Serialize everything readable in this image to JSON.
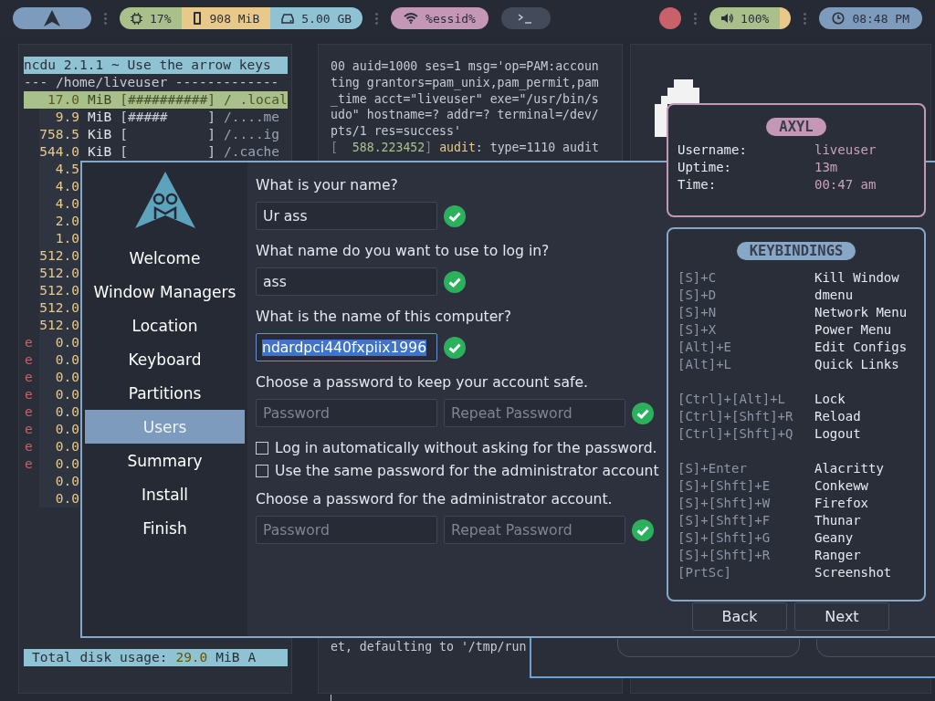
{
  "top_bar": {
    "system": [
      {
        "kind": "cpu",
        "text": "17%",
        "color": "#a9c08a"
      },
      {
        "kind": "memory",
        "text": "908 MiB",
        "color": "#e9c98a"
      },
      {
        "kind": "disk",
        "text": "5.00 GB",
        "color": "#8fc3d3"
      }
    ],
    "network": {
      "text": "%essid%"
    },
    "volume": {
      "text": "100%"
    },
    "clock": {
      "text": "08:48 PM"
    }
  },
  "ncdu": {
    "header": "ncdu 2.1.1 ~ Use the arrow keys",
    "path_line": "--- /home/liveuser -------------",
    "rows": [
      {
        "size": "17.0",
        "unit": "MiB",
        "bar": "[##########]",
        "name": "/ .local",
        "selected": true
      },
      {
        "size": "9.9",
        "unit": "MiB",
        "bar": "[#####     ]",
        "name": "/....me",
        "selected": false
      },
      {
        "size": "758.5",
        "unit": "KiB",
        "bar": "[          ]",
        "name": "/....ig",
        "selected": false
      },
      {
        "size": "544.0",
        "unit": "KiB",
        "bar": "[          ]",
        "name": "/.cache",
        "selected": false
      },
      {
        "size": "4.5",
        "selected": false
      },
      {
        "size": "4.0",
        "selected": false
      },
      {
        "size": "4.0",
        "selected": false
      },
      {
        "size": "2.0",
        "selected": false
      },
      {
        "size": "1.0",
        "selected": false
      },
      {
        "size": "512.0",
        "selected": false
      },
      {
        "size": "512.0",
        "selected": false
      },
      {
        "size": "512.0",
        "selected": false
      },
      {
        "size": "512.0",
        "selected": false
      },
      {
        "size": "512.0",
        "selected": false
      },
      {
        "size": "0.0",
        "flag": "e",
        "selected": false
      },
      {
        "size": "0.0",
        "flag": "e",
        "selected": false
      },
      {
        "size": "0.0",
        "flag": "e",
        "selected": false
      },
      {
        "size": "0.0",
        "flag": "e",
        "selected": false
      },
      {
        "size": "0.0",
        "flag": "e",
        "selected": false
      },
      {
        "size": "0.0",
        "flag": "e",
        "selected": false
      },
      {
        "size": "0.0",
        "flag": "e",
        "selected": false
      },
      {
        "size": "0.0",
        "flag": "e",
        "selected": false
      },
      {
        "size": "0.0",
        "selected": false
      },
      {
        "size": "0.0",
        "selected": false
      }
    ],
    "footer": {
      "label": "Total disk usage:",
      "value": "29.0",
      "unit": "MiB",
      "extra": "A"
    }
  },
  "terminal": {
    "lines": [
      "00 auid=1000 ses=1 msg='op=PAM:accoun",
      "ting grantors=pam_unix,pam_permit,pam",
      "_time acct=\"liveuser\" exe=\"/usr/bin/s",
      "udo\" hostname=? addr=? terminal=/dev/",
      "pts/1 res=success'"
    ],
    "log_entry": {
      "open": "[  ",
      "timestamp": "588.223452",
      "close": "]",
      "source": "audit",
      "message": ": type=1110 audit"
    },
    "bottom_line": "et, defaulting to '/tmp/run"
  },
  "installer": {
    "steps": [
      {
        "label": "Welcome",
        "selected": false
      },
      {
        "label": "Window Managers",
        "selected": false
      },
      {
        "label": "Location",
        "selected": false
      },
      {
        "label": "Keyboard",
        "selected": false
      },
      {
        "label": "Partitions",
        "selected": false
      },
      {
        "label": "Users",
        "selected": true
      },
      {
        "label": "Summary",
        "selected": false
      },
      {
        "label": "Install",
        "selected": false
      },
      {
        "label": "Finish",
        "selected": false
      }
    ],
    "sections": [
      {
        "kind": "text",
        "label": "What is your name?",
        "value": "Ur ass",
        "valid": true
      },
      {
        "kind": "text",
        "label": "What name do you want to use to log in?",
        "value": "ass",
        "valid": true
      },
      {
        "kind": "text",
        "label": "What is the name of this computer?",
        "value": "ndardpci440fxpiix1996",
        "text_selected": true,
        "valid": true
      },
      {
        "kind": "password",
        "label": "Choose a password to keep your account safe.",
        "placeholder": "Password",
        "repeat_placeholder": "Repeat Password",
        "valid": true
      },
      {
        "kind": "checkbox",
        "label": "Log in automatically without asking for the password.",
        "checked": false
      },
      {
        "kind": "checkbox",
        "label": "Use the same password for the administrator account",
        "checked": false
      },
      {
        "kind": "password",
        "label": "Choose a password for the administrator account.",
        "placeholder": "Password",
        "repeat_placeholder": "Repeat Password",
        "valid": true
      }
    ],
    "buttons": [
      "Back",
      "Next"
    ]
  },
  "profile": {
    "title": "AXYL",
    "rows": [
      {
        "label": "Username:",
        "value": "liveuser"
      },
      {
        "label": "Uptime:",
        "value": "13m"
      },
      {
        "label": "Time:",
        "value": "00:47 am"
      }
    ]
  },
  "keybindings": {
    "title": "KEYBINDINGS",
    "groups": [
      {
        "items": [
          {
            "keys": "[S]+C",
            "action": "Kill Window"
          },
          {
            "keys": "[S]+D",
            "action": "dmenu"
          },
          {
            "keys": "[S]+N",
            "action": "Network Menu"
          },
          {
            "keys": "[S]+X",
            "action": "Power Menu"
          },
          {
            "keys": "[Alt]+E",
            "action": "Edit Configs"
          },
          {
            "keys": "[Alt]+L",
            "action": "Quick Links"
          }
        ]
      },
      {
        "items": [
          {
            "keys": "[Ctrl]+[Alt]+L",
            "action": "Lock"
          },
          {
            "keys": "[Ctrl]+[Shft]+R",
            "action": "Reload"
          },
          {
            "keys": "[Ctrl]+[Shft]+Q",
            "action": "Logout"
          }
        ]
      },
      {
        "items": [
          {
            "keys": "[S]+Enter",
            "action": "Alacritty"
          },
          {
            "keys": "[S]+[Shft]+E",
            "action": "Conkeww"
          },
          {
            "keys": "[S]+[Shft]+W",
            "action": "Firefox"
          },
          {
            "keys": "[S]+[Shft]+F",
            "action": "Thunar"
          },
          {
            "keys": "[S]+[Shft]+G",
            "action": "Geany"
          },
          {
            "keys": "[S]+[Shft]+R",
            "action": "Ranger"
          },
          {
            "keys": "[PrtSc]",
            "action": "Screenshot"
          }
        ]
      }
    ]
  }
}
